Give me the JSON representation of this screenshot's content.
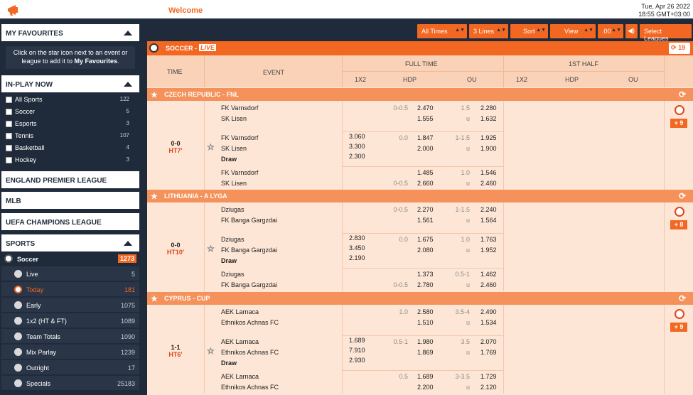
{
  "header": {
    "welcome": "Welcome",
    "date": "Tue, Apr 26 2022",
    "time": "18:55 GMT+03:00"
  },
  "sidebar": {
    "favourites_title": "MY FAVOURITES",
    "favourites_msg_1": "Click on the star icon next to an event or",
    "favourites_msg_2": "league to add it to ",
    "favourites_msg_bold": "My Favourites",
    "favourites_msg_end": ".",
    "inplay_title": "IN-PLAY NOW",
    "inplay": [
      {
        "label": "All Sports",
        "count": "122"
      },
      {
        "label": "Soccer",
        "count": "5"
      },
      {
        "label": "Esports",
        "count": "3"
      },
      {
        "label": "Tennis",
        "count": "107"
      },
      {
        "label": "Basketball",
        "count": "4"
      },
      {
        "label": "Hockey",
        "count": "3"
      }
    ],
    "links": [
      "ENGLAND PREMIER LEAGUE",
      "MLB",
      "UEFA CHAMPIONS LEAGUE"
    ],
    "sports_title": "SPORTS",
    "soccer": {
      "label": "Soccer",
      "count": "1273"
    },
    "soccer_items": [
      {
        "label": "Live",
        "count": "5"
      },
      {
        "label": "Today",
        "count": "181"
      },
      {
        "label": "Early",
        "count": "1075"
      },
      {
        "label": "1x2 (HT & FT)",
        "count": "1089"
      },
      {
        "label": "Team Totals",
        "count": "1090"
      },
      {
        "label": "Mix Parlay",
        "count": "1239"
      },
      {
        "label": "Outright",
        "count": "17"
      },
      {
        "label": "Specials",
        "count": "25183"
      }
    ]
  },
  "filters": {
    "times": "All Times",
    "lines": "3 Lines",
    "sort": "Sort",
    "view": "View",
    "odds": ".00",
    "leagues": "Select Leagues"
  },
  "main": {
    "title": "SOCCER - ",
    "live": "LIVE",
    "refresh_count": "19",
    "cols": {
      "time": "TIME",
      "event": "EVENT",
      "full_time": "FULL TIME",
      "first_half": "1ST HALF",
      "x12": "1X2",
      "hdp": "HDP",
      "ou": "OU",
      "x12b": "1X2",
      "hdpb": "HDP",
      "oub": "OU"
    },
    "leagues": [
      {
        "name": "CZECH REPUBLIC - FNL",
        "score": "0-0",
        "period": "HT7'",
        "more": "+ 9",
        "lines": [
          {
            "home": "FK Varnsdorf",
            "away": "SK Lisen",
            "draw": "",
            "x1": "",
            "x2": "",
            "xd": "",
            "hdp_h": "0-0.5",
            "hdp_a": "",
            "odds_h": "2.470",
            "odds_a": "1.555",
            "ou_h": "1.5",
            "ou_a": "u",
            "ouo_h": "2.280",
            "ouo_a": "1.632"
          },
          {
            "home": "FK Varnsdorf",
            "away": "SK Lisen",
            "draw": "Draw",
            "x1": "3.060",
            "x2": "3.300",
            "xd": "2.300",
            "hdp_h": "0.0",
            "hdp_a": "",
            "odds_h": "1.847",
            "odds_a": "2.000",
            "ou_h": "1-1.5",
            "ou_a": "u",
            "ouo_h": "1.925",
            "ouo_a": "1.900"
          },
          {
            "home": "FK Varnsdorf",
            "away": "SK Lisen",
            "draw": "",
            "x1": "",
            "x2": "",
            "xd": "",
            "hdp_h": "",
            "hdp_a": "0-0.5",
            "odds_h": "1.485",
            "odds_a": "2.660",
            "ou_h": "1.0",
            "ou_a": "u",
            "ouo_h": "1.546",
            "ouo_a": "2.460"
          }
        ]
      },
      {
        "name": "LITHUANIA - A LYGA",
        "score": "0-0",
        "period": "HT10'",
        "more": "+ 8",
        "lines": [
          {
            "home": "Dziugas",
            "away": "FK Banga Gargzdai",
            "draw": "",
            "x1": "",
            "x2": "",
            "xd": "",
            "hdp_h": "0-0.5",
            "hdp_a": "",
            "odds_h": "2.270",
            "odds_a": "1.561",
            "ou_h": "1-1.5",
            "ou_a": "u",
            "ouo_h": "2.240",
            "ouo_a": "1.564"
          },
          {
            "home": "Dziugas",
            "away": "FK Banga Gargzdai",
            "draw": "Draw",
            "x1": "2.830",
            "x2": "3.450",
            "xd": "2.190",
            "hdp_h": "0.0",
            "hdp_a": "",
            "odds_h": "1.675",
            "odds_a": "2.080",
            "ou_h": "1.0",
            "ou_a": "u",
            "ouo_h": "1.763",
            "ouo_a": "1.952"
          },
          {
            "home": "Dziugas",
            "away": "FK Banga Gargzdai",
            "draw": "",
            "x1": "",
            "x2": "",
            "xd": "",
            "hdp_h": "",
            "hdp_a": "0-0.5",
            "odds_h": "1.373",
            "odds_a": "2.780",
            "ou_h": "0.5-1",
            "ou_a": "u",
            "ouo_h": "1.462",
            "ouo_a": "2.460"
          }
        ]
      },
      {
        "name": "CYPRUS - CUP",
        "score": "1-1",
        "period": "HT6'",
        "more": "+ 9",
        "lines": [
          {
            "home": "AEK Larnaca",
            "away": "Ethnikos Achnas FC",
            "draw": "",
            "x1": "",
            "x2": "",
            "xd": "",
            "hdp_h": "1.0",
            "hdp_a": "",
            "odds_h": "2.580",
            "odds_a": "1.510",
            "ou_h": "3.5-4",
            "ou_a": "u",
            "ouo_h": "2.490",
            "ouo_a": "1.534"
          },
          {
            "home": "AEK Larnaca",
            "away": "Ethnikos Achnas FC",
            "draw": "Draw",
            "x1": "1.689",
            "x2": "7.910",
            "xd": "2.930",
            "hdp_h": "0.5-1",
            "hdp_a": "",
            "odds_h": "1.980",
            "odds_a": "1.869",
            "ou_h": "3.5",
            "ou_a": "u",
            "ouo_h": "2.070",
            "ouo_a": "1.769"
          },
          {
            "home": "AEK Larnaca",
            "away": "Ethnikos Achnas FC",
            "draw": "",
            "x1": "",
            "x2": "",
            "xd": "",
            "hdp_h": "0.5",
            "hdp_a": "",
            "odds_h": "1.689",
            "odds_a": "2.200",
            "ou_h": "3-3.5",
            "ou_a": "u",
            "ouo_h": "1.729",
            "ouo_a": "2.120"
          }
        ]
      }
    ]
  }
}
